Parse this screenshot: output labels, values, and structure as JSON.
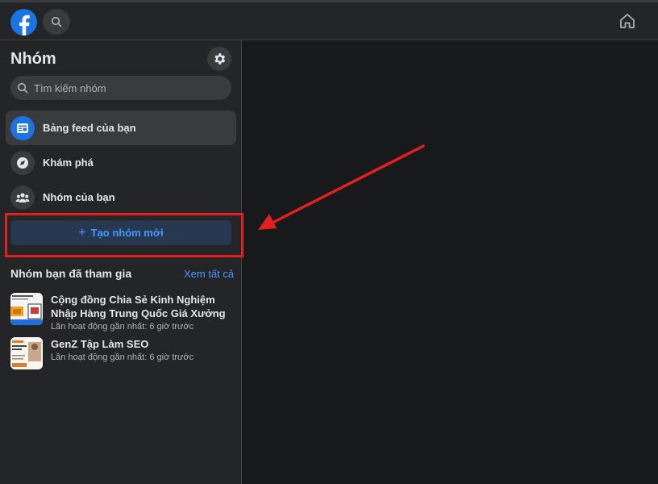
{
  "header": {
    "logo_icon": "facebook-logo-icon",
    "search_icon": "search-icon",
    "home_icon": "home-icon"
  },
  "sidebar": {
    "title": "Nhóm",
    "settings_icon": "gear-icon",
    "search": {
      "placeholder": "Tìm kiếm nhóm"
    },
    "nav": [
      {
        "label": "Bảng feed của bạn",
        "icon": "feed-icon",
        "active": true
      },
      {
        "label": "Khám phá",
        "icon": "compass-icon",
        "active": false
      },
      {
        "label": "Nhóm của bạn",
        "icon": "groups-icon",
        "active": false
      }
    ],
    "create_button": {
      "label": "Tạo nhóm mới",
      "icon": "plus-icon"
    },
    "joined_section": {
      "title": "Nhóm bạn đã tham gia",
      "see_all": "Xem tất cả",
      "groups": [
        {
          "name": "Cộng đồng Chia Sẻ Kinh Nghiệm Nhập Hàng Trung Quốc Giá Xưởng",
          "activity": "Lần hoạt động gần nhất: 6 giờ trước"
        },
        {
          "name": "GenZ Tập Làm SEO",
          "activity": "Lần hoạt động gần nhất: 6 giờ trước"
        }
      ]
    }
  },
  "colors": {
    "background": "#18191a",
    "panel": "#242526",
    "accent": "#1b74e4",
    "link": "#4599ff",
    "annotation": "#e41f1f"
  },
  "annotation": {
    "type": "red-arrow-and-box",
    "target": "create_button"
  }
}
